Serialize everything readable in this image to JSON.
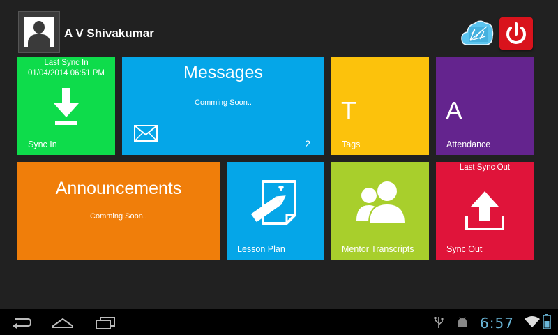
{
  "header": {
    "user_name": "A V Shivakumar",
    "avatar_icon": "user-avatar-icon",
    "cloud_icon": "cloud-sync-icon",
    "power_icon": "power-icon"
  },
  "tiles": {
    "sync_in": {
      "caption": "Last Sync In",
      "timestamp": "01/04/2014 06:51 PM",
      "label": "Sync In",
      "icon": "download-arrow-icon",
      "color": "#0edc4b"
    },
    "messages": {
      "title": "Messages",
      "status": "Comming Soon..",
      "count": "2",
      "icon": "envelope-icon",
      "color": "#05a6e8"
    },
    "tags": {
      "letter": "T",
      "label": "Tags",
      "color": "#fcc20c"
    },
    "attendance": {
      "letter": "A",
      "label": "Attendance",
      "color": "#64248e"
    },
    "announcements": {
      "title": "Announcements",
      "status": "Comming Soon..",
      "color": "#f07e0a"
    },
    "lesson_plan": {
      "label": "Lesson Plan",
      "icon": "note-pencil-icon",
      "color": "#05a6e8"
    },
    "mentor_transcripts": {
      "label": "Mentor Transcripts",
      "icon": "users-icon",
      "color": "#a8cf2c"
    },
    "sync_out": {
      "caption": "Last Sync Out",
      "label": "Sync Out",
      "icon": "upload-arrow-icon",
      "color": "#e0143a"
    }
  },
  "navbar": {
    "back_icon": "back-icon",
    "home_icon": "home-icon",
    "recents_icon": "recent-apps-icon",
    "usb_icon": "usb-icon",
    "android_icon": "android-debug-icon",
    "clock": "6:57",
    "wifi_icon": "wifi-icon",
    "battery_icon": "battery-icon"
  }
}
